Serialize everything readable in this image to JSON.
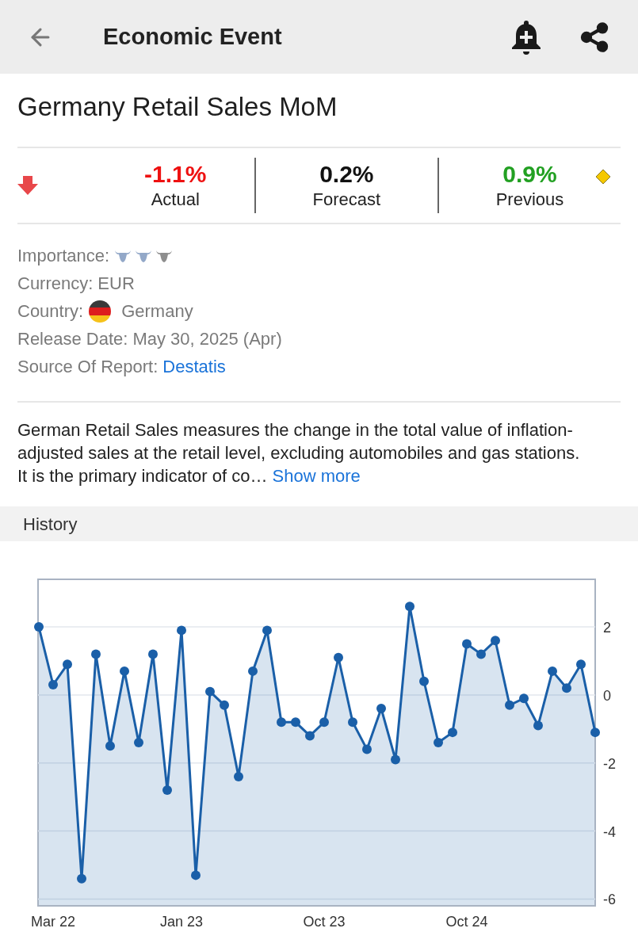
{
  "header": {
    "title": "Economic Event"
  },
  "event": {
    "title": "Germany Retail Sales MoM"
  },
  "stats": [
    {
      "value": "-1.1%",
      "label": "Actual",
      "color": "#ee1111"
    },
    {
      "value": "0.2%",
      "label": "Forecast",
      "color": "#111111"
    },
    {
      "value": "0.9%",
      "label": "Previous",
      "color": "#22a022"
    }
  ],
  "details": [
    {
      "kind": "importance",
      "label": "Importance:",
      "stars": 2
    },
    {
      "kind": "text",
      "label": "Currency:",
      "value": "EUR"
    },
    {
      "kind": "country",
      "label": "Country:",
      "value": "Germany"
    },
    {
      "kind": "text",
      "label": "Release Date:",
      "value": "May 30, 2025 (Apr)"
    },
    {
      "kind": "link",
      "label": "Source Of Report:",
      "value": "Destatis"
    }
  ],
  "description": {
    "text": "German Retail Sales measures the change in the total value of inflation-adjusted sales at the retail level, excluding automobiles and gas stations. It is the primary indicator of co…",
    "more": "Show more"
  },
  "history": {
    "title": "History",
    "chart_data": {
      "type": "area",
      "grid": true,
      "categories": [
        null,
        "Mar 22",
        null,
        null,
        null,
        null,
        null,
        null,
        null,
        null,
        "Jan 23",
        null,
        null,
        null,
        null,
        null,
        null,
        null,
        null,
        null,
        "Oct 23",
        null,
        null,
        null,
        null,
        null,
        null,
        null,
        null,
        null,
        "Oct 24",
        null,
        null,
        null,
        null,
        null,
        null,
        null,
        null,
        null
      ],
      "series": [
        {
          "color": "#1a5fa8",
          "values": [
            2.0,
            0.3,
            0.9,
            -5.4,
            1.2,
            -1.5,
            0.7,
            -1.4,
            1.2,
            -2.8,
            1.9,
            -5.3,
            0.1,
            -0.3,
            -2.4,
            0.7,
            1.9,
            -0.8,
            -0.8,
            -1.2,
            -0.8,
            1.1,
            -0.8,
            -1.6,
            -0.4,
            -1.9,
            2.6,
            0.4,
            -1.4,
            -1.1,
            1.5,
            1.2,
            1.6,
            -0.3,
            -0.1,
            -0.9,
            0.7,
            0.2,
            0.9,
            -1.1
          ]
        }
      ],
      "ylim": [
        -6.2,
        3.4
      ],
      "yticks": [
        2,
        0,
        -2,
        -4,
        -6
      ]
    }
  }
}
